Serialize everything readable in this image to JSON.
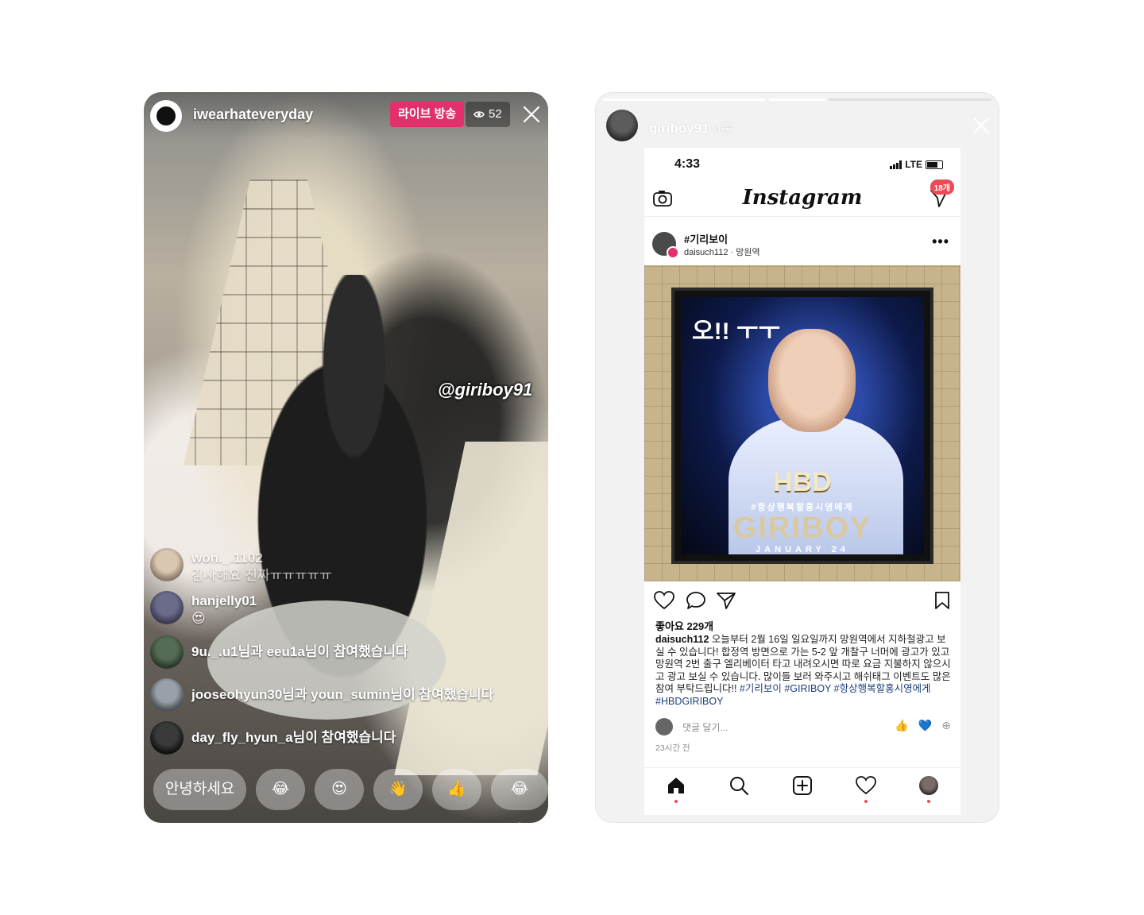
{
  "live": {
    "username": "iwearhateveryday",
    "live_badge": "라이브 방송",
    "viewer_count": "52",
    "mention": "@giriboy91",
    "comments": [
      {
        "user": "won._.1102",
        "text": "감사해요 진짜ㅠㅠㅠㅠㅠ",
        "dim": true
      },
      {
        "user": "hanjelly01",
        "text": "😍"
      },
      {
        "user": "",
        "text": "9u._.u1님과 eeu1a님이 참여했습니다"
      },
      {
        "user": "",
        "text": "jooseohyun30님과 youn_sumin님이 참여했습니다"
      },
      {
        "user": "",
        "text": "day_fly_hyun_a님이 참여했습니다"
      }
    ],
    "quick_replies": [
      "안녕하세요",
      "😂",
      "😍",
      "👋",
      "👍",
      "😂😂"
    ]
  },
  "story": {
    "username": "giriboy91",
    "time_ago": "4분",
    "ig": {
      "clock": "4:33",
      "network": "LTE",
      "logo": "Instagram",
      "dm_badge": "18개",
      "post_title": "#기리보이",
      "post_user": "daisuch112",
      "post_location": "망원역",
      "poster": {
        "headline": "오!! ㅜㅜ",
        "hbd": "HBD",
        "tagline": "#항상행복할홍시영에게",
        "name": "GIRIBOY",
        "date": "JANUARY 24"
      },
      "likes": "좋아요 229개",
      "caption_user": "daisuch112",
      "caption_text": "오늘부터 2월 16일 일요일까지 망원역에서 지하철광고 보실 수 있습니다! 합정역 방면으로 가는 5-2 앞 개찰구 너머에 광고가 있고 망원역 2번 출구 엘리베이터 타고 내려오시면 따로 요금 지불하지 않으시고 광고 보실 수 있습니다. 많이들 보러 와주시고 해쉬태그 이벤트도 많은 참여 부탁드립니다!!",
      "caption_tags": "#기리보이 #GIRIBOY #항상행복할홍시영에게 #HBDGIRIBOY",
      "comment_placeholder": "댓글 달기...",
      "react_icons": [
        "👍",
        "💙",
        "⊕"
      ],
      "time_ago": "23시간 전"
    }
  },
  "colors": {
    "live_badge": "#e1306c",
    "ig_notification": "#ed4956",
    "hashtag": "#1c3f7a"
  }
}
